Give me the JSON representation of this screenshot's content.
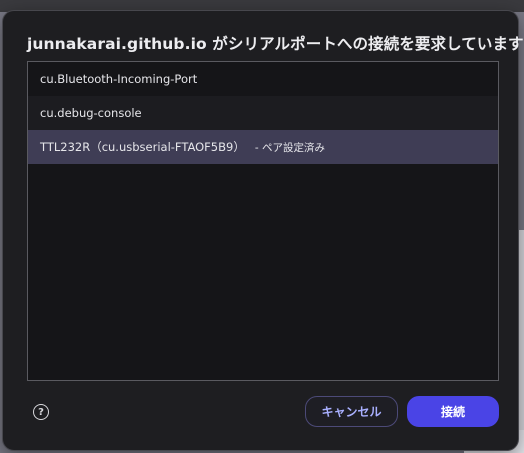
{
  "dialog": {
    "title": "junnakarai.github.io がシリアルポートへの接続を要求しています",
    "ports": [
      {
        "name": "cu.Bluetooth-Incoming-Port",
        "badge": ""
      },
      {
        "name": "cu.debug-console",
        "badge": ""
      },
      {
        "name": "TTL232R（cu.usbserial-FTAOF5B9）",
        "badge": "- ペア設定済み"
      }
    ],
    "help_icon": "question-circle-icon",
    "help_glyph": "?",
    "cancel_label": "キャンセル",
    "connect_label": "接続"
  },
  "colors": {
    "dialog_bg": "#1e1e21",
    "selected_row": "#3f3d55",
    "accent": "#4a44e6",
    "cancel_text": "#a9b0ff"
  }
}
